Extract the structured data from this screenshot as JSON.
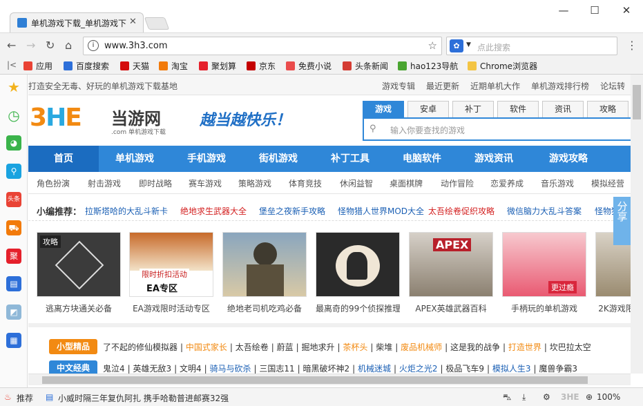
{
  "browser": {
    "tab_title": "单机游戏下载_单机游戏下",
    "url": "www.3h3.com",
    "search_placeholder": "点此搜索",
    "window_controls": [
      "—",
      "☐",
      "✕"
    ]
  },
  "bookmarks": [
    {
      "label": "应用",
      "icon": "apps-icon",
      "color": "#e94335"
    },
    {
      "label": "百度搜索",
      "icon": "baidu-icon",
      "color": "#2d6fd9"
    },
    {
      "label": "天猫",
      "icon": "tmall-icon",
      "color": "#d40c0c"
    },
    {
      "label": "淘宝",
      "icon": "taobao-icon",
      "color": "#f27a0a"
    },
    {
      "label": "聚划算",
      "icon": "juhuasuan-icon",
      "color": "#e5202b"
    },
    {
      "label": "京东",
      "icon": "jd-icon",
      "color": "#c40000"
    },
    {
      "label": "免费小说",
      "icon": "novel-icon",
      "color": "#ea4c4c"
    },
    {
      "label": "头条新闻",
      "icon": "toutiao-icon",
      "color": "#d43c33"
    },
    {
      "label": "hao123导航",
      "icon": "hao123-icon",
      "color": "#4aa531"
    },
    {
      "label": "Chrome浏览器",
      "icon": "folder-icon",
      "color": "#f3c443"
    }
  ],
  "site": {
    "slogan": "打造安全无毒、好玩的单机游戏下载基地",
    "top_links": [
      "游戏专辑",
      "最近更新",
      "近期单机大作",
      "单机游戏排行榜",
      "论坛转"
    ],
    "logo_text": "当游网",
    "logo_sub": ".com 单机游戏下载",
    "tagline": "越当越快乐！",
    "search_tabs": [
      "游戏",
      "安卓",
      "补丁",
      "软件",
      "资讯",
      "攻略"
    ],
    "search_placeholder": "输入你要查找的游戏",
    "main_nav": [
      "首页",
      "单机游戏",
      "手机游戏",
      "街机游戏",
      "补丁工具",
      "电脑软件",
      "游戏资讯",
      "游戏攻略"
    ],
    "sub_nav": [
      "角色扮演",
      "射击游戏",
      "即时战略",
      "赛车游戏",
      "策略游戏",
      "体育竞技",
      "休闲益智",
      "桌面棋牌",
      "动作冒险",
      "恋爱养成",
      "音乐游戏",
      "模拟经营"
    ],
    "rec_label": "小编推荐：",
    "rec_items": [
      {
        "text": "拉斯塔哈的大乱斗新卡",
        "color": "#1a5fb4"
      },
      {
        "text": "绝地求生武器大全",
        "color": "#d31f1f"
      },
      {
        "text": "堡垒之夜新手攻略",
        "color": "#1a5fb4"
      },
      {
        "text": "怪物猎人世界MOD大全",
        "color": "#1a5fb4"
      },
      {
        "text": "太吾绘卷促织攻略",
        "color": "#d31f1f"
      },
      {
        "text": "微信脑力大乱斗答案",
        "color": "#1a5fb4"
      },
      {
        "text": "怪物猎",
        "color": "#1a5fb4"
      }
    ],
    "cards": [
      {
        "caption": "逃离方块通关必备",
        "badge": "攻略"
      },
      {
        "caption": "EA游戏限时活动专区",
        "badge": "限时折扣活动",
        "sub": "EA专区"
      },
      {
        "caption": "绝地老司机吃鸡必备"
      },
      {
        "caption": "最离奇的99个侦探推理"
      },
      {
        "caption": "APEX英雄武器百科",
        "badge": "APEX"
      },
      {
        "caption": "手柄玩的单机游戏",
        "badge": "更过瘾"
      },
      {
        "caption": "2K游戏限"
      }
    ],
    "cat_rows": [
      {
        "badge": "小型精品",
        "color": "#f28a12",
        "items": [
          {
            "text": "了不起的修仙模拟器",
            "color": "#333"
          },
          {
            "text": "中国式家长",
            "color": "#f28a12"
          },
          {
            "text": "太吾绘卷",
            "color": "#333"
          },
          {
            "text": "蔚蓝",
            "color": "#333"
          },
          {
            "text": "掘地求升",
            "color": "#333"
          },
          {
            "text": "茶杯头",
            "color": "#f28a12"
          },
          {
            "text": "柴堆",
            "color": "#333"
          },
          {
            "text": "废品机械师",
            "color": "#f28a12"
          },
          {
            "text": "这是我的战争",
            "color": "#333"
          },
          {
            "text": "打造世界",
            "color": "#f28a12"
          },
          {
            "text": "坎巴拉太空",
            "color": "#333"
          }
        ]
      },
      {
        "badge": "中文经典",
        "color": "#2f87d8",
        "items": [
          {
            "text": "鬼泣4",
            "color": "#333"
          },
          {
            "text": "英雄无敌3",
            "color": "#333"
          },
          {
            "text": "文明4",
            "color": "#333"
          },
          {
            "text": "骑马与砍杀",
            "color": "#1a5fb4"
          },
          {
            "text": "三国志11",
            "color": "#333"
          },
          {
            "text": "暗黑破坏神2",
            "color": "#333"
          },
          {
            "text": "机械迷城",
            "color": "#1a5fb4"
          },
          {
            "text": "火炬之光2",
            "color": "#1a5fb4"
          },
          {
            "text": "极品飞车9",
            "color": "#333"
          },
          {
            "text": "模拟人生3",
            "color": "#1a5fb4"
          },
          {
            "text": "魔兽争霸3",
            "color": "#333"
          }
        ]
      }
    ],
    "share": "分享"
  },
  "status": {
    "recommend": "推荐",
    "news": "小威时隔三年复仇阿扎 携手哈勒普进邮赛32强",
    "zoom": "100%"
  }
}
